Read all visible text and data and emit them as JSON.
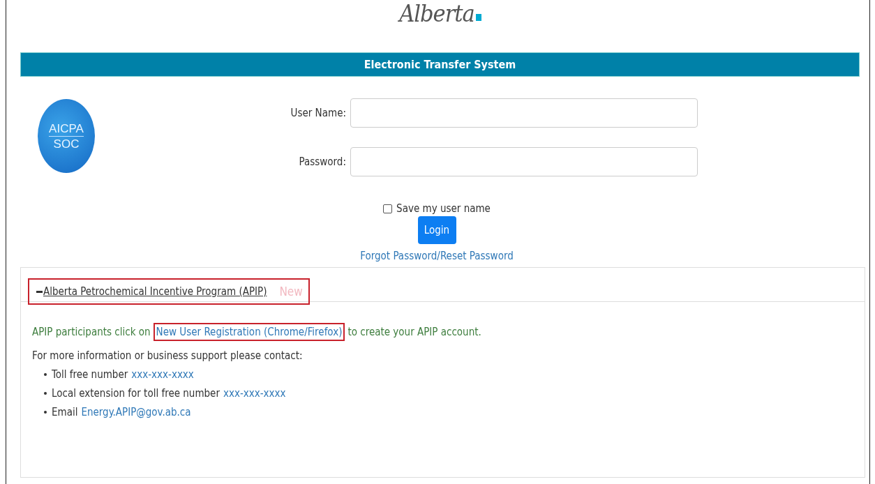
{
  "logo": {
    "text": "Alberta"
  },
  "banner": {
    "title": "Electronic Transfer System"
  },
  "badge": {
    "line_1": "AICPA",
    "line_2": "SOC"
  },
  "form": {
    "fields": [
      {
        "label": "User Name:"
      },
      {
        "label": "Password:"
      }
    ],
    "remember": {
      "label": "Save my user name",
      "checked": false
    },
    "login_button": "Login",
    "forgot_link": "Forgot Password/Reset Password"
  },
  "section": {
    "title": "Alberta Petrochemical Incentive Program (APIP)",
    "expanded": true,
    "tag": "New",
    "highlighted": true,
    "intro": {
      "before": "APIP participants click on",
      "link": "New User Registration (Chrome/Firefox)",
      "link_highlighted": true,
      "after": "to create your APIP account."
    },
    "contact_heading": "For more information or business support please contact:",
    "contacts": [
      {
        "label": "Toll free number",
        "value": "xxx-xxx-xxxx"
      },
      {
        "label": "Local extension for toll free number",
        "value": "xxx-xxx-xxxx"
      },
      {
        "label": "Email",
        "value": "Energy.APIP@gov.ab.ca"
      }
    ]
  }
}
